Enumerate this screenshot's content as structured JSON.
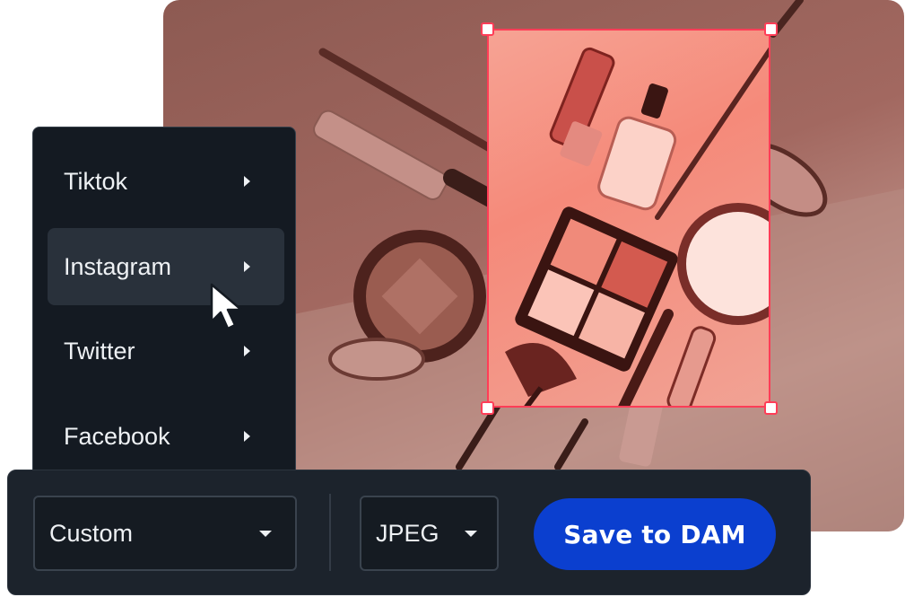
{
  "share_menu": {
    "items": [
      {
        "label": "Tiktok"
      },
      {
        "label": "Instagram"
      },
      {
        "label": "Twitter"
      },
      {
        "label": "Facebook"
      }
    ],
    "active_item": "Instagram"
  },
  "toolbar": {
    "size_select": {
      "value": "Custom"
    },
    "format_select": {
      "value": "JPEG"
    },
    "save_label": "Save to DAM"
  },
  "colors": {
    "accent_blue": "#0b3fcf",
    "crop_border": "#ff3d57",
    "panel_dark": "#141a22",
    "photo_tint": "#a26860"
  },
  "icons": {
    "submenu": "chevron-right-icon",
    "dropdown": "caret-down-icon",
    "pointer": "mouse-cursor-icon"
  }
}
